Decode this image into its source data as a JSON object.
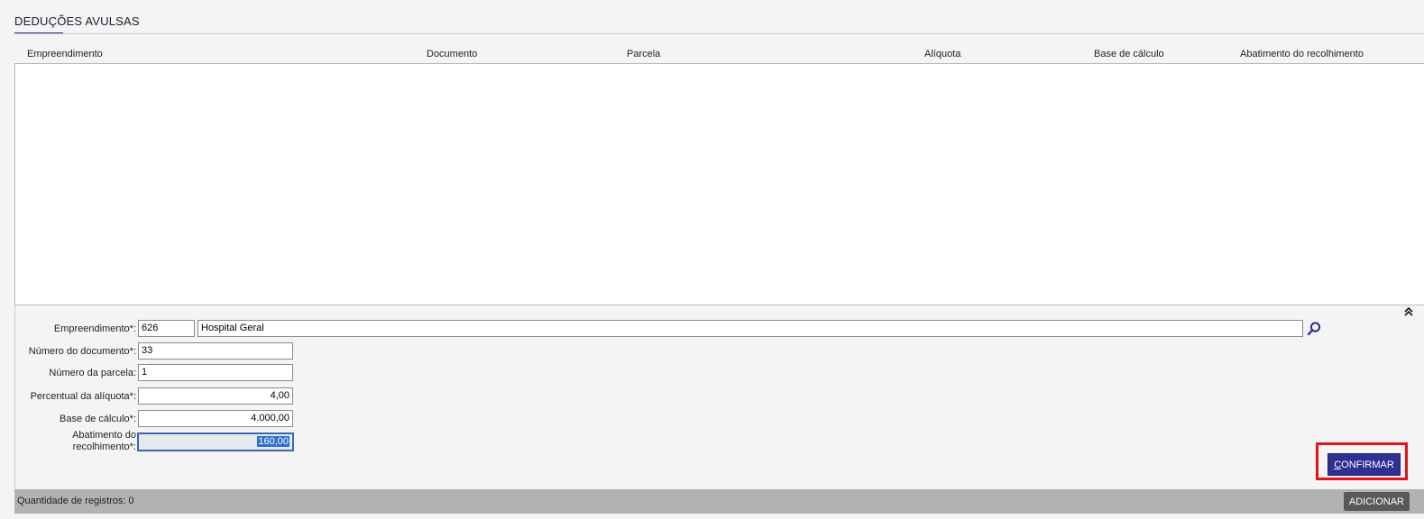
{
  "section": {
    "title": "DEDUÇÕES AVULSAS"
  },
  "grid": {
    "columns": [
      "Empreendimento",
      "Documento",
      "Parcela",
      "Alíquota",
      "Base de cálculo",
      "Abatimento do recolhimento"
    ],
    "rows": []
  },
  "form": {
    "empreendimento": {
      "label": "Empreendimento*:",
      "code": "626",
      "name": "Hospital Geral"
    },
    "numero_documento": {
      "label": "Número do documento*:",
      "value": "33"
    },
    "numero_parcela": {
      "label": "Número da parcela:",
      "value": "1"
    },
    "percentual_aliquota": {
      "label": "Percentual da alíquota*:",
      "value": "4,00"
    },
    "base_calculo": {
      "label": "Base de cálculo*:",
      "value": "4.000,00"
    },
    "abatimento": {
      "label_line1": "Abatimento do",
      "label_line2": "recolhimento*:",
      "value": "160,00"
    },
    "confirm": {
      "label_first": "C",
      "label_rest": "ONFIRMAR"
    }
  },
  "footer": {
    "count_label": "Quantidade de registros: 0",
    "add_label": "ADICIONAR"
  },
  "icons": {
    "lookup": "search-icon",
    "collapse": "double-chevron-up-icon"
  },
  "colors": {
    "primary": "#2e3192",
    "highlight": "#e0151b",
    "selection": "#2f6fcd"
  }
}
